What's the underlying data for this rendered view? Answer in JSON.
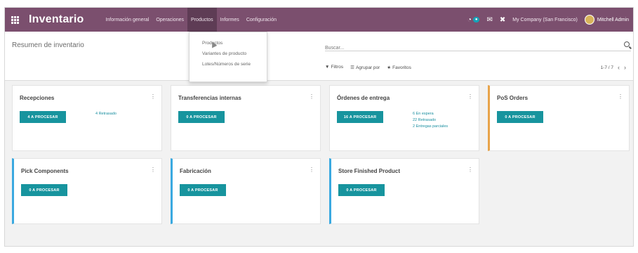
{
  "navbar": {
    "app_name": "Inventario",
    "menu": [
      "Información general",
      "Operaciones",
      "Productos",
      "Informes",
      "Configuración"
    ],
    "active_menu": "Productos",
    "activity_badge": "●",
    "company": "My Company (San Francisco)",
    "user": "Mitchell Admin"
  },
  "dropdown": {
    "items": [
      "Productos",
      "Variantes de producto",
      "Lotes/Números de serie"
    ]
  },
  "control": {
    "breadcrumb": "Resumen de inventario",
    "search_placeholder": "Buscar...",
    "filters_label": "Filtros",
    "groupby_label": "Agrupar por",
    "favorites_label": "Favoritos",
    "pager": "1-7 / 7"
  },
  "cards": [
    {
      "title": "Recepciones",
      "button": "4 A PROCESAR",
      "links": [
        "4 Retrasado"
      ]
    },
    {
      "title": "Transferencias internas",
      "button": "0 A PROCESAR",
      "links": []
    },
    {
      "title": "Órdenes de entrega",
      "button": "16 A PROCESAR",
      "links": [
        "6 En espera",
        "22 Retrasado",
        "2 Entregas parciales"
      ]
    },
    {
      "title": "PoS Orders",
      "button": "0 A PROCESAR",
      "links": []
    },
    {
      "title": "Pick Components",
      "button": "0 A PROCESAR",
      "links": []
    },
    {
      "title": "Fabricación",
      "button": "0 A PROCESAR",
      "links": []
    },
    {
      "title": "Store Finished Product",
      "button": "0 A PROCESAR",
      "links": []
    }
  ],
  "colors": {
    "navbar": "#7b4f6e",
    "primary_button": "#17949e",
    "accent_orange": "#e8a44a",
    "accent_blue": "#3aa9e0"
  }
}
